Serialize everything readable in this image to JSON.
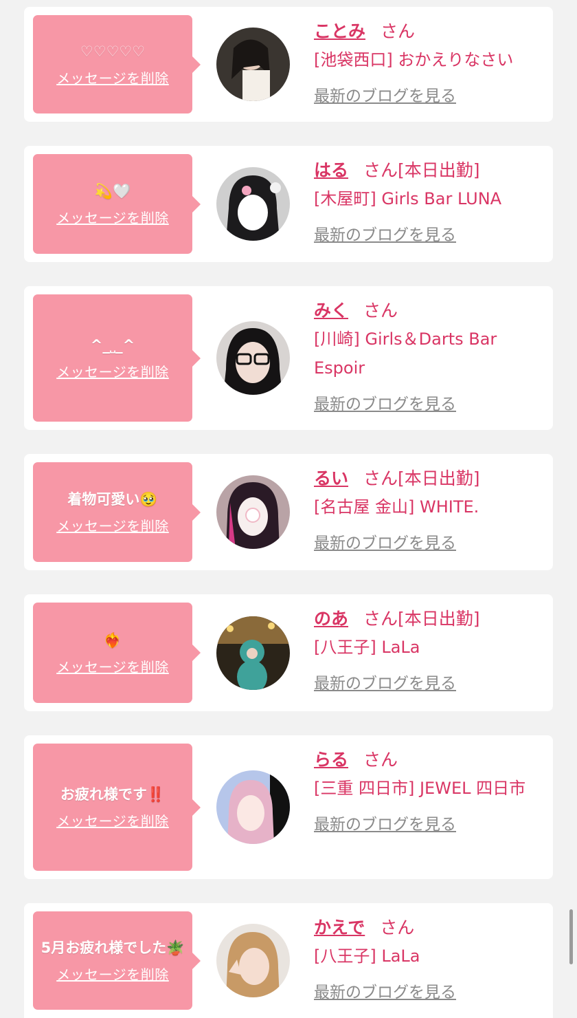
{
  "delete_label": "メッセージを削除",
  "blog_label": "最新のブログを見る",
  "honorific": "さん",
  "colors": {
    "accent": "#d93564",
    "bubble": "#f797a6",
    "background": "#f2f2f2"
  },
  "cards": [
    {
      "message": "♡♡♡♡♡",
      "name": "ことみ",
      "tag": "",
      "shop": "[池袋西口] おかえりなさい"
    },
    {
      "message": "💫🤍",
      "name": "はる",
      "tag": "[本日出勤]",
      "shop": "[木屋町] Girls Bar LUNA"
    },
    {
      "message": "^_˽_^",
      "name": "みく",
      "tag": "",
      "shop": "[川崎] Girls＆Darts Bar Espoir"
    },
    {
      "message": "着物可愛い🥹",
      "name": "るい",
      "tag": "[本日出勤]",
      "shop": "[名古屋 金山] WHITE."
    },
    {
      "message": "❤️‍🔥",
      "name": "のあ",
      "tag": "[本日出勤]",
      "shop": "[八王子] LaLa"
    },
    {
      "message": "お疲れ様です‼️",
      "name": "らる",
      "tag": "",
      "shop": "[三重 四日市] JEWEL 四日市"
    },
    {
      "message": "5月お疲れ様でした🪴",
      "name": "かえで",
      "tag": "",
      "shop": "[八王子] LaLa"
    }
  ]
}
